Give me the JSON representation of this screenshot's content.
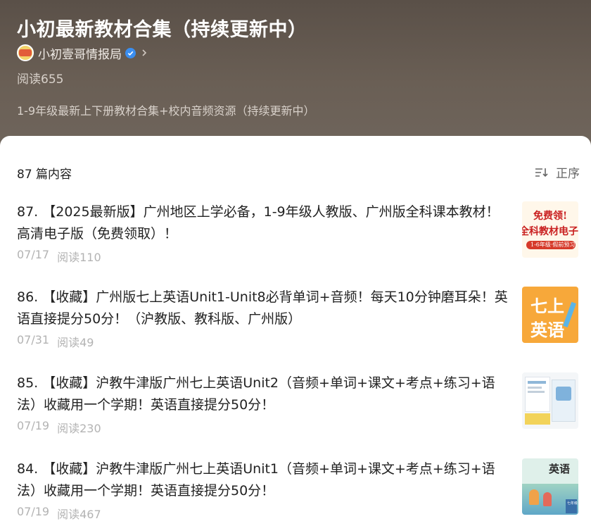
{
  "header": {
    "title": "小初最新教材合集（持续更新中）",
    "author": "小初壹哥情报局",
    "reads": "阅读655",
    "description": "1-9年级最新上下册教材合集+校内音频资源（持续更新中）"
  },
  "list": {
    "count_label": "87 篇内容",
    "sort_label": "正序",
    "items": [
      {
        "title": "87. 【2025最新版】广州地区上学必备，1-9年级人教版、广州版全科课本教材！高清电子版（免费领取）！",
        "date": "07/17",
        "views": "阅读110",
        "thumb_text_1": "免费领!",
        "thumb_text_2": "全科教材电子",
        "thumb_text_3": "1-6年级·假前预习"
      },
      {
        "title": "86. 【收藏】广州版七上英语Unit1-Unit8必背单词+音频！每天10分钟磨耳朵！英语直接提分50分！（沪教版、教科版、广州版）",
        "date": "07/31",
        "views": "阅读49",
        "thumb_text_1": "七上",
        "thumb_text_2": "英语"
      },
      {
        "title": "85. 【收藏】沪教牛津版广州七上英语Unit2（音频+单词+课文+考点+练习+语法）收藏用一个学期！英语直接提分50分！",
        "date": "07/19",
        "views": "阅读230"
      },
      {
        "title": "84. 【收藏】沪教牛津版广州七上英语Unit1（音频+单词+课文+考点+练习+语法）收藏用一个学期！英语直接提分50分！",
        "date": "07/19",
        "views": "阅读467",
        "thumb_text_1": "英语",
        "thumb_text_2": "七年级"
      }
    ]
  },
  "colors": {
    "header_bg": "#5f554c",
    "verified": "#3a8ef0",
    "meta_text": "#b3b3b3"
  },
  "icons": {
    "verified": "verified-check-icon",
    "chevron": "chevron-right-icon",
    "sort": "sort-lines-icon"
  }
}
